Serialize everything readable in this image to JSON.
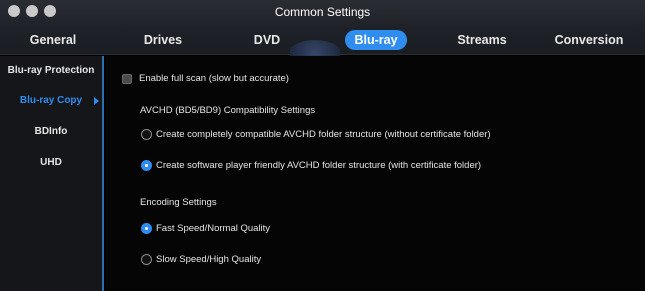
{
  "window": {
    "title": "Common Settings"
  },
  "tabs": [
    {
      "label": "General"
    },
    {
      "label": "Drives"
    },
    {
      "label": "DVD"
    },
    {
      "label": "Blu-ray"
    },
    {
      "label": "Streams"
    },
    {
      "label": "Conversion"
    }
  ],
  "active_tab": "Blu-ray",
  "sidebar": {
    "items": [
      {
        "label": "Blu-ray Protection"
      },
      {
        "label": "Blu-ray Copy"
      },
      {
        "label": "BDInfo"
      },
      {
        "label": "UHD"
      }
    ],
    "active": "Blu-ray Copy"
  },
  "main": {
    "full_scan": {
      "label": "Enable full scan (slow but accurate)",
      "checked": false
    },
    "avchd": {
      "heading": "AVCHD (BD5/BD9) Compatibility Settings",
      "options": [
        {
          "label": "Create completely compatible AVCHD folder structure (without certificate folder)",
          "selected": false
        },
        {
          "label": "Create software player friendly AVCHD folder structure (with certificate folder)",
          "selected": true
        }
      ]
    },
    "encoding": {
      "heading": "Encoding Settings",
      "options": [
        {
          "label": "Fast Speed/Normal Quality",
          "selected": true
        },
        {
          "label": "Slow Speed/High Quality",
          "selected": false
        }
      ]
    }
  },
  "colors": {
    "accent": "#2f8df0",
    "background": "#050505",
    "sidebar": "#141619"
  }
}
